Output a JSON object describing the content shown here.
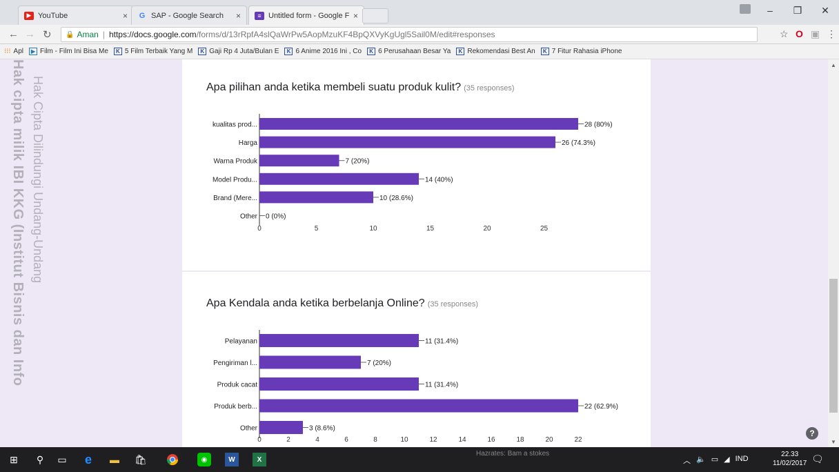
{
  "browser": {
    "tabs": [
      {
        "title": "YouTube",
        "favicon": "youtube-icon",
        "color": "#e62117"
      },
      {
        "title": "SAP - Google Search",
        "favicon": "google-icon",
        "color": "#4285f4"
      },
      {
        "title": "Untitled form - Google F",
        "favicon": "google-forms-icon",
        "color": "#673ab7"
      }
    ],
    "security_label": "Aman",
    "url_host": "https://docs.google.com",
    "url_path": "/forms/d/13rRpfA4slQaWrPw5AopMzuKF4BpQXVyKgUgl5Sail0M/edit#responses"
  },
  "bookmarks": [
    "Apl",
    "Film - Film Ini Bisa Me",
    "5 Film Terbaik Yang M",
    "Gaji Rp 4 Juta/Bulan E",
    "6 Anime 2016 Ini , Co",
    "6 Perusahaan Besar Ya",
    "Rekomendasi Best An",
    "7 Fitur Rahasia iPhone"
  ],
  "watermark": {
    "line1": "Hak cipta milik IBI KKG (Institut Bisnis dan Info",
    "line2": "Hak Cipta Dilindungi Undang-Undang"
  },
  "questions": [
    {
      "title": "Apa pilihan anda ketika membeli suatu produk kulit?",
      "responses": "(35 responses)"
    },
    {
      "title": "Apa Kendala anda ketika berbelanja Online?",
      "responses": "(35 responses)"
    }
  ],
  "chart_data": [
    {
      "type": "bar",
      "orientation": "horizontal",
      "title": "Apa pilihan anda ketika membeli suatu produk kulit?",
      "categories": [
        "kualitas prod...",
        "Harga",
        "Warna Produk",
        "Model Produ...",
        "Brand (Mere...",
        "Other"
      ],
      "values": [
        28,
        26,
        7,
        14,
        10,
        0
      ],
      "labels": [
        "28 (80%)",
        "26 (74.3%)",
        "7 (20%)",
        "14 (40%)",
        "10 (28.6%)",
        "0 (0%)"
      ],
      "xticks": [
        0,
        5,
        10,
        15,
        20,
        25
      ],
      "xlim": [
        0,
        28
      ],
      "color": "#673ab7",
      "grid": false
    },
    {
      "type": "bar",
      "orientation": "horizontal",
      "title": "Apa Kendala anda ketika berbelanja Online?",
      "categories": [
        "Pelayanan",
        "Pengiriman l...",
        "Produk cacat",
        "Produk berb...",
        "Other"
      ],
      "values": [
        11,
        7,
        11,
        22,
        3
      ],
      "labels": [
        "11 (31.4%)",
        "7 (20%)",
        "11 (31.4%)",
        "22 (62.9%)",
        "3 (8.6%)"
      ],
      "xticks": [
        0,
        2,
        4,
        6,
        8,
        10,
        12,
        14,
        16,
        18,
        20,
        22
      ],
      "xlim": [
        0,
        22
      ],
      "color": "#673ab7",
      "grid": false
    }
  ],
  "taskbar": {
    "notification": "Hazrates: Bam a stokes",
    "language": "IND",
    "time": "22.33",
    "date": "11/02/2017"
  }
}
